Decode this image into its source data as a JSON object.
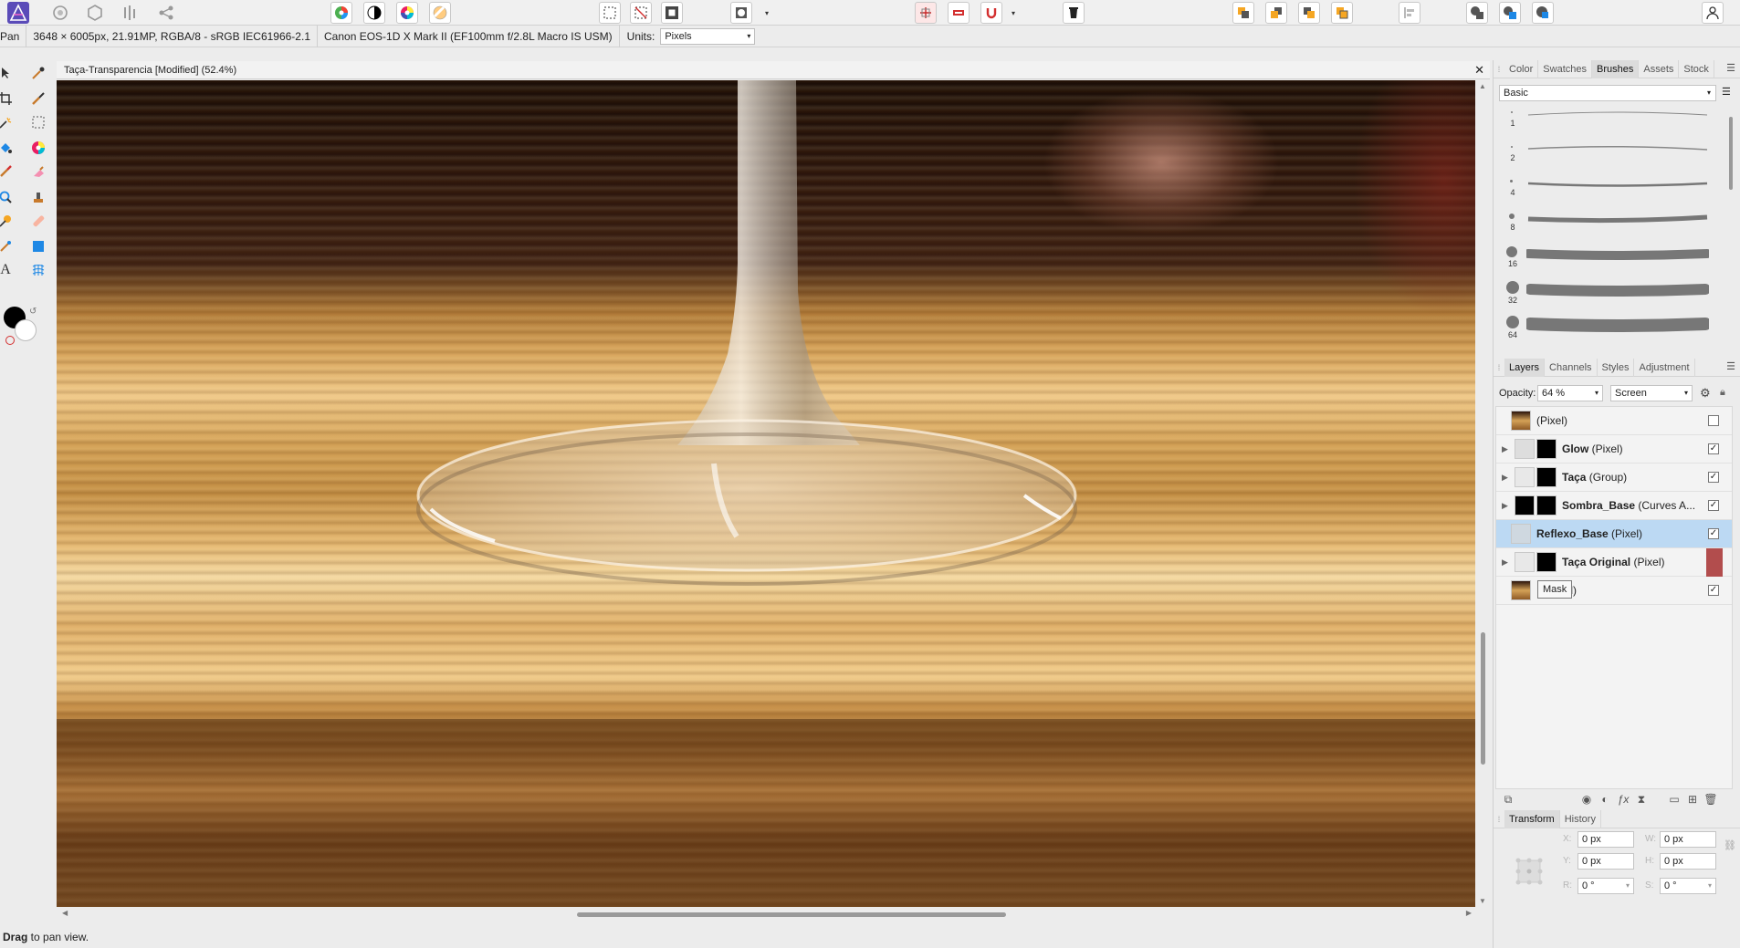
{
  "toolbar": {
    "icons": [
      "affinity-photo-logo",
      "photo-persona-icon",
      "liquify-persona-icon",
      "develop-persona-icon",
      "export-persona-icon",
      "share-icon",
      "color-wheel-icon",
      "contrast-icon",
      "hue-icon",
      "white-balance-icon",
      "marquee-rect-icon",
      "deselect-icon",
      "invert-selection-icon",
      "refine-mask-icon",
      "align-icon",
      "snapping-icon",
      "magnet-icon",
      "erase-icon",
      "arrange-back-icon",
      "arrange-backward-icon",
      "arrange-forward-icon",
      "arrange-front-icon",
      "align-left-icon",
      "boolean-add-icon",
      "boolean-subtract-icon",
      "boolean-intersect-icon",
      "user-icon"
    ]
  },
  "context": {
    "tool_label": "Pan",
    "doc_info": "3648 × 6005px, 21.91MP, RGBA/8 - sRGB IEC61966-2.1",
    "camera": "Canon EOS-1D X Mark II (EF100mm f/2.8L Macro IS USM)",
    "units_label": "Units:",
    "units_value": "Pixels"
  },
  "document": {
    "title": "Taça-Transparencia [Modified] (52.4%)",
    "close": "✕"
  },
  "status": {
    "bold": "Drag",
    "rest": " to pan view."
  },
  "panel_top": {
    "tabs": [
      "Color",
      "Swatches",
      "Brushes",
      "Assets",
      "Stock"
    ],
    "active": "Brushes",
    "category": "Basic",
    "brush_sizes": [
      "1",
      "2",
      "4",
      "8",
      "16",
      "32",
      "64"
    ]
  },
  "panel_layers": {
    "tabs": [
      "Layers",
      "Channels",
      "Styles",
      "Adjustment"
    ],
    "active": "Layers",
    "opacity_label": "Opacity:",
    "opacity_value": "64 %",
    "blend_value": "Screen",
    "layers": [
      {
        "name": "",
        "kind": "(Pixel)",
        "checked": false
      },
      {
        "name": "Glow",
        "kind": " (Pixel)",
        "checked": true
      },
      {
        "name": "Taça",
        "kind": " (Group)",
        "checked": true
      },
      {
        "name": "Sombra_Base",
        "kind": " (Curves A...",
        "checked": true
      },
      {
        "name": "Reflexo_Base",
        "kind": " (Pixel)",
        "checked": true
      },
      {
        "name": "Taça Original",
        "kind": " (Pixel)",
        "checked": false
      },
      {
        "name": "",
        "kind": "ixel)",
        "checked": true
      }
    ],
    "tooltip": "Mask"
  },
  "panel_transform": {
    "tabs": [
      "Transform",
      "History"
    ],
    "active": "Transform",
    "x_label": "X:",
    "x_value": "0 px",
    "y_label": "Y:",
    "y_value": "0 px",
    "w_label": "W:",
    "w_value": "0 px",
    "h_label": "H:",
    "h_value": "0 px",
    "r_label": "R:",
    "r_value": "0 °",
    "s_label": "S:",
    "s_value": "0 °"
  },
  "colors": {
    "accent": "#4a3aa6",
    "selection": "#bcd9f3",
    "warning_red": "#b24d4d"
  }
}
